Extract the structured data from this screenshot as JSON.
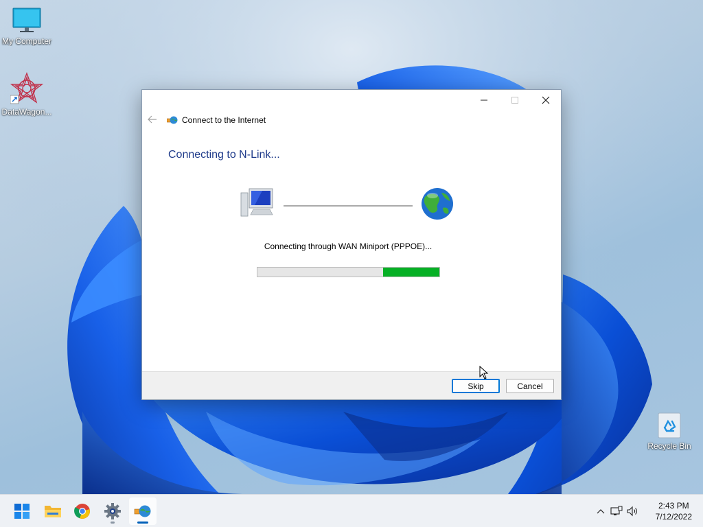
{
  "desktop": {
    "icons": [
      {
        "label": "My Computer",
        "icon": "monitor-icon"
      },
      {
        "label": "DataWagon...",
        "icon": "datawagon-shortcut-icon"
      },
      {
        "label": "Recycle Bin",
        "icon": "recycle-bin-icon"
      }
    ]
  },
  "window": {
    "title": "Connect to the Internet",
    "heading": "Connecting to N-Link...",
    "status": "Connecting through WAN Miniport (PPPOE)...",
    "progress": 0.31,
    "buttons": {
      "skip": "Skip",
      "cancel": "Cancel"
    },
    "controls": [
      "minimize-icon",
      "maximize-icon",
      "close-icon"
    ]
  },
  "taskbar": {
    "apps": [
      "start-icon",
      "file-explorer-icon",
      "chrome-icon",
      "settings-icon",
      "network-connect-icon"
    ],
    "active_app": "network-connect-icon",
    "tray": [
      "chevron-up-icon",
      "network-icon",
      "volume-icon"
    ],
    "time": "2:43 PM",
    "date": "7/12/2022"
  },
  "colors": {
    "accent": "#0078d7",
    "heading": "#1e3a8a",
    "progress": "#06b025"
  }
}
